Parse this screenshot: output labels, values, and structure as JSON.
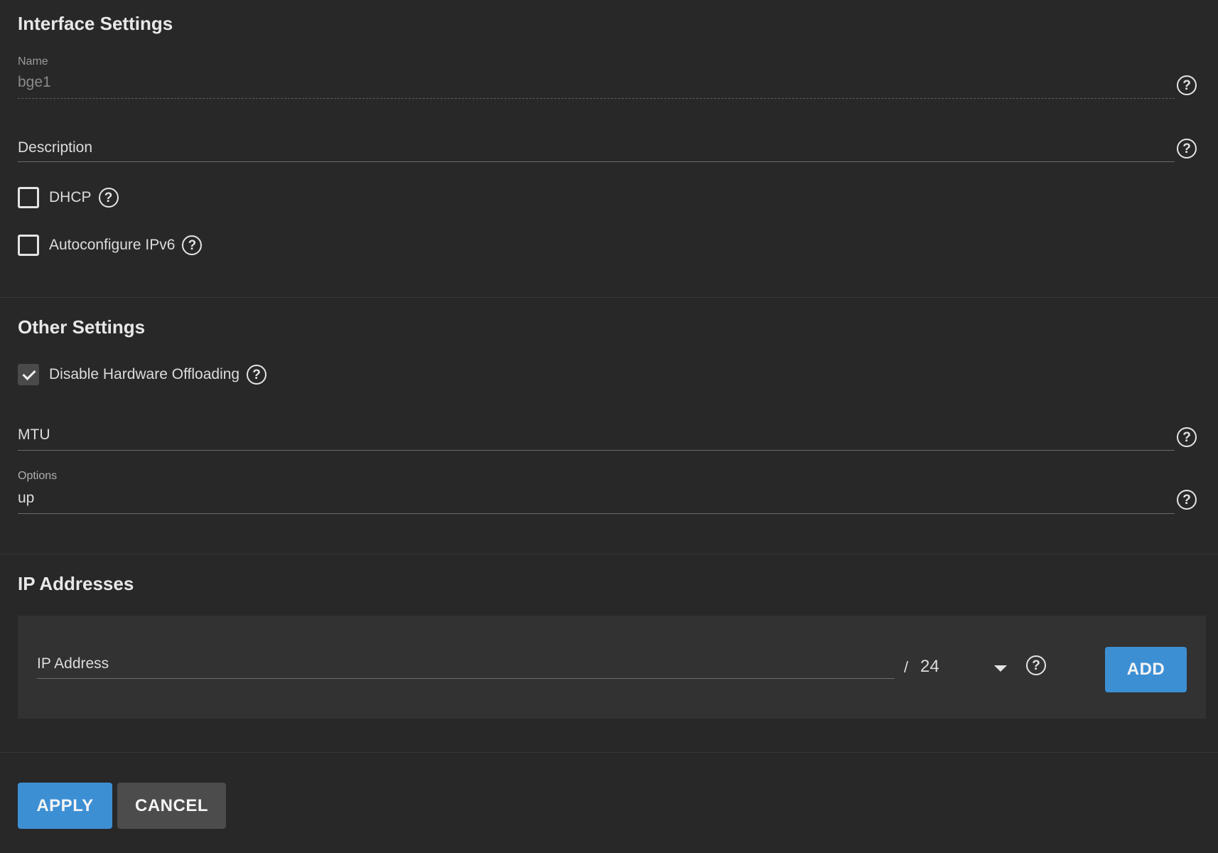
{
  "interface_settings": {
    "title": "Interface Settings",
    "name_label": "Name",
    "name_value": "bge1",
    "description_label": "Description",
    "dhcp_label": "DHCP",
    "dhcp_checked": false,
    "autoconfig_label": "Autoconfigure IPv6",
    "autoconfig_checked": false
  },
  "other_settings": {
    "title": "Other Settings",
    "disable_offload_label": "Disable Hardware Offloading",
    "disable_offload_checked": true,
    "mtu_label": "MTU",
    "options_label": "Options",
    "options_value": "up"
  },
  "ip_addresses": {
    "title": "IP Addresses",
    "ip_label": "IP Address",
    "slash": "/",
    "cidr_value": "24",
    "add_label": "ADD"
  },
  "actions": {
    "apply_label": "APPLY",
    "cancel_label": "CANCEL"
  },
  "icons": {
    "help": "help-circle-icon",
    "dropdown": "caret-down-icon",
    "check": "checkmark-icon"
  },
  "colors": {
    "background": "#282828",
    "panel": "#323232",
    "primary": "#3d8fd4",
    "secondary": "#4c4c4c"
  }
}
